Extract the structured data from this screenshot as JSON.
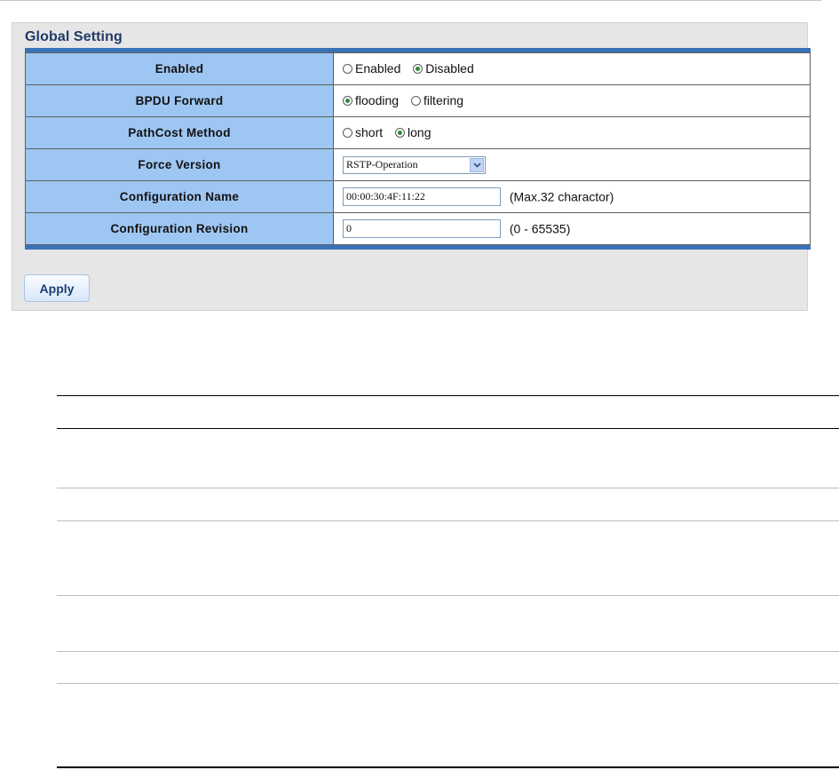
{
  "panel": {
    "title": "Global Setting",
    "rows": [
      {
        "label": "Enabled"
      },
      {
        "label": "BPDU Forward"
      },
      {
        "label": "PathCost Method"
      },
      {
        "label": "Force Version"
      },
      {
        "label": "Configuration Name"
      },
      {
        "label": "Configuration Revision"
      }
    ],
    "enabled": {
      "opt1": "Enabled",
      "opt2": "Disabled",
      "selected": "Disabled"
    },
    "bpdu_forward": {
      "opt1": "flooding",
      "opt2": "filtering",
      "selected": "flooding"
    },
    "pathcost": {
      "opt1": "short",
      "opt2": "long",
      "selected": "long"
    },
    "force_version": {
      "value": "RSTP-Operation"
    },
    "config_name": {
      "value": "00:00:30:4F:11:22",
      "hint": "(Max.32 charactor)"
    },
    "config_revision": {
      "value": "0",
      "hint": "(0 - 65535)"
    },
    "apply_label": "Apply"
  },
  "colors": {
    "accent": "#3a72b8",
    "label_bg": "#9ec6f2",
    "radio_on": "#2f8a3a"
  }
}
